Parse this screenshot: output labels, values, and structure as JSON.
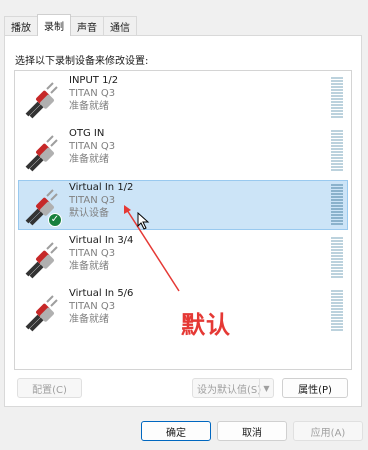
{
  "tabs": [
    {
      "label": "播放"
    },
    {
      "label": "录制"
    },
    {
      "label": "声音"
    },
    {
      "label": "通信"
    }
  ],
  "instruction": "选择以下录制设备来修改设置:",
  "devices": [
    {
      "name": "INPUT 1/2",
      "model": "TITAN Q3",
      "status": "准备就绪",
      "selected": false,
      "default": false
    },
    {
      "name": "OTG IN",
      "model": "TITAN Q3",
      "status": "准备就绪",
      "selected": false,
      "default": false
    },
    {
      "name": "Virtual In 1/2",
      "model": "TITAN Q3",
      "status": "默认设备",
      "selected": true,
      "default": true
    },
    {
      "name": "Virtual In 3/4",
      "model": "TITAN Q3",
      "status": "准备就绪",
      "selected": false,
      "default": false
    },
    {
      "name": "Virtual In 5/6",
      "model": "TITAN Q3",
      "status": "准备就绪",
      "selected": false,
      "default": false
    }
  ],
  "buttons": {
    "configure": "配置(C)",
    "set_default": "设为默认值(S)",
    "properties": "属性(P)",
    "ok": "确定",
    "cancel": "取消",
    "apply": "应用(A)"
  },
  "annotation": "默认",
  "colors": {
    "selection": "#cce4f7",
    "annotation": "#e53935",
    "check": "#17803d"
  }
}
